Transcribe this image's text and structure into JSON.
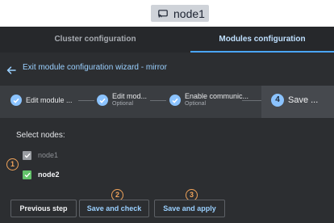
{
  "node_chip": {
    "name": "node1",
    "icon": "monitor-icon"
  },
  "tabs": [
    {
      "label": "Cluster configuration",
      "active": false
    },
    {
      "label": "Modules configuration",
      "active": true
    }
  ],
  "wizard": {
    "exit_label": "Exit module configuration wizard - mirror"
  },
  "steps": [
    {
      "label": "Edit module ...",
      "sub": "",
      "status": "done"
    },
    {
      "label": "Edit mod...",
      "sub": "Optional",
      "status": "done"
    },
    {
      "label": "Enable communic...",
      "sub": "Optional",
      "status": "done"
    },
    {
      "number": "4",
      "label": "Save ...",
      "status": "active"
    }
  ],
  "select_title": "Select nodes:",
  "nodes": [
    {
      "label": "node1",
      "checked": true,
      "disabled": true
    },
    {
      "label": "node2",
      "checked": true,
      "disabled": false
    }
  ],
  "callouts": [
    "1",
    "2",
    "3"
  ],
  "buttons": {
    "previous": "Previous step",
    "save_check": "Save and check",
    "save_apply": "Save and apply"
  },
  "colors": {
    "accent": "#4aa6ff",
    "link": "#9ad0ff",
    "check_green": "#63c36a",
    "callout_orange": "#f0a35a",
    "panel": "#2c2e31"
  }
}
